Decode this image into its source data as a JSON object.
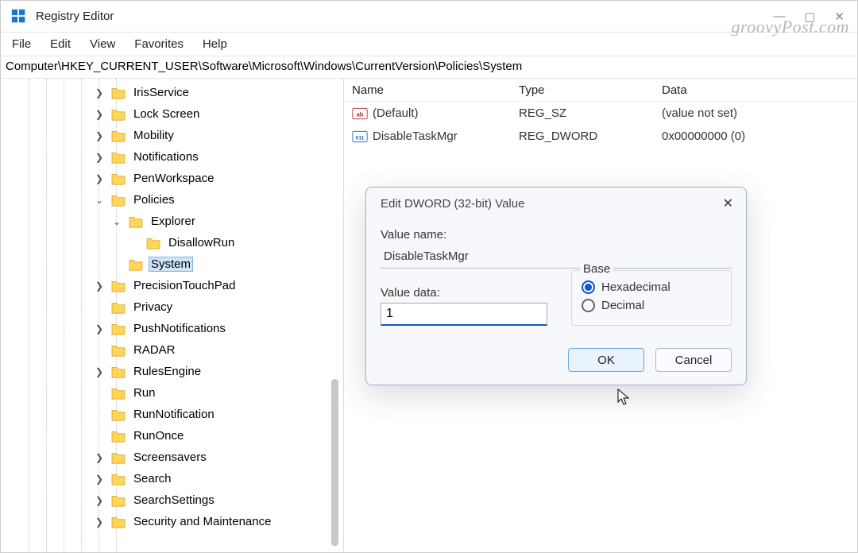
{
  "app": {
    "title": "Registry Editor"
  },
  "menu": [
    "File",
    "Edit",
    "View",
    "Favorites",
    "Help"
  ],
  "address": "Computer\\HKEY_CURRENT_USER\\Software\\Microsoft\\Windows\\CurrentVersion\\Policies\\System",
  "watermark": "groovyPost.com",
  "tree": [
    {
      "indent": 5,
      "exp": ">",
      "label": "IrisService"
    },
    {
      "indent": 5,
      "exp": ">",
      "label": "Lock Screen"
    },
    {
      "indent": 5,
      "exp": ">",
      "label": "Mobility"
    },
    {
      "indent": 5,
      "exp": ">",
      "label": "Notifications"
    },
    {
      "indent": 5,
      "exp": ">",
      "label": "PenWorkspace"
    },
    {
      "indent": 5,
      "exp": "v",
      "label": "Policies"
    },
    {
      "indent": 6,
      "exp": "v",
      "label": "Explorer"
    },
    {
      "indent": 7,
      "exp": " ",
      "label": "DisallowRun"
    },
    {
      "indent": 6,
      "exp": " ",
      "label": "System",
      "selected": true
    },
    {
      "indent": 5,
      "exp": ">",
      "label": "PrecisionTouchPad"
    },
    {
      "indent": 5,
      "exp": " ",
      "label": "Privacy"
    },
    {
      "indent": 5,
      "exp": ">",
      "label": "PushNotifications"
    },
    {
      "indent": 5,
      "exp": " ",
      "label": "RADAR"
    },
    {
      "indent": 5,
      "exp": ">",
      "label": "RulesEngine"
    },
    {
      "indent": 5,
      "exp": " ",
      "label": "Run"
    },
    {
      "indent": 5,
      "exp": " ",
      "label": "RunNotification"
    },
    {
      "indent": 5,
      "exp": " ",
      "label": "RunOnce"
    },
    {
      "indent": 5,
      "exp": ">",
      "label": "Screensavers"
    },
    {
      "indent": 5,
      "exp": ">",
      "label": "Search"
    },
    {
      "indent": 5,
      "exp": ">",
      "label": "SearchSettings"
    },
    {
      "indent": 5,
      "exp": ">",
      "label": "Security and Maintenance"
    }
  ],
  "list": {
    "cols": {
      "name": "Name",
      "type": "Type",
      "data": "Data"
    },
    "rows": [
      {
        "icon": "str",
        "name": "(Default)",
        "type": "REG_SZ",
        "data": "(value not set)"
      },
      {
        "icon": "bin",
        "name": "DisableTaskMgr",
        "type": "REG_DWORD",
        "data": "0x00000000 (0)"
      }
    ]
  },
  "dialog": {
    "title": "Edit DWORD (32-bit) Value",
    "value_name_label": "Value name:",
    "value_name": "DisableTaskMgr",
    "value_data_label": "Value data:",
    "value_data": "1",
    "base_label": "Base",
    "hex_label": "Hexadecimal",
    "dec_label": "Decimal",
    "ok": "OK",
    "cancel": "Cancel"
  }
}
